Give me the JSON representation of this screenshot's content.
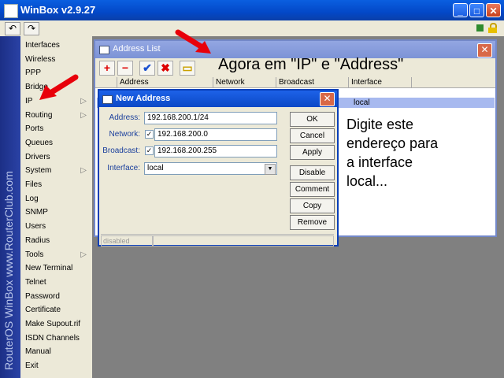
{
  "window": {
    "title": "WinBox v2.9.27"
  },
  "brand": {
    "vertical_text": "RouterOS WinBox   www.RouterClub.com"
  },
  "menu": {
    "items": [
      {
        "label": "Interfaces"
      },
      {
        "label": "Wireless"
      },
      {
        "label": "PPP"
      },
      {
        "label": "Bridge"
      },
      {
        "label": "IP",
        "submenu": true
      },
      {
        "label": "Routing",
        "submenu": true
      },
      {
        "label": "Ports"
      },
      {
        "label": "Queues"
      },
      {
        "label": "Drivers"
      },
      {
        "label": "System",
        "submenu": true
      },
      {
        "label": "Files"
      },
      {
        "label": "Log"
      },
      {
        "label": "SNMP"
      },
      {
        "label": "Users"
      },
      {
        "label": "Radius"
      },
      {
        "label": "Tools",
        "submenu": true
      },
      {
        "label": "New Terminal"
      },
      {
        "label": "Telnet"
      },
      {
        "label": "Password"
      },
      {
        "label": "Certificate"
      },
      {
        "label": "Make Supout.rif"
      },
      {
        "label": "ISDN Channels"
      },
      {
        "label": "Manual"
      },
      {
        "label": "Exit"
      }
    ]
  },
  "address_list": {
    "title": "Address List",
    "columns": [
      "Address",
      "Network",
      "Broadcast",
      "Interface"
    ],
    "selected_row_interface": "local"
  },
  "annotations": {
    "top": "Agora em \"IP\" e \"Address\"",
    "side_lines": [
      "Digite este",
      "endereço para",
      "a interface",
      "local..."
    ]
  },
  "new_address": {
    "title": "New Address",
    "address_label": "Address:",
    "address_value": "192.168.200.1/24",
    "network_label": "Network:",
    "network_value": "192.168.200.0",
    "network_checked": true,
    "broadcast_label": "Broadcast:",
    "broadcast_value": "192.168.200.255",
    "broadcast_checked": true,
    "interface_label": "Interface:",
    "interface_value": "local",
    "buttons": [
      "OK",
      "Cancel",
      "Apply",
      "Disable",
      "Comment",
      "Copy",
      "Remove"
    ],
    "status": "disabled"
  },
  "colors": {
    "titlebar": "#0348c8",
    "arrow": "#e8000a",
    "selected_row": "#a7b9ef"
  }
}
